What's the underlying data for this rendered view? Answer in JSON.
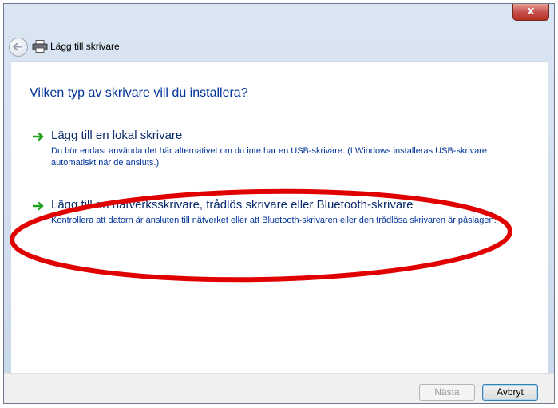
{
  "window": {
    "close_glyph": "x"
  },
  "header": {
    "title": "Lägg till skrivare"
  },
  "content": {
    "question": "Vilken typ av skrivare vill du installera?",
    "options": [
      {
        "title": "Lägg till en lokal skrivare",
        "description": "Du bör endast använda det här alternativet om du inte har en USB-skrivare. (I Windows installeras USB-skrivare automatiskt när de ansluts.)"
      },
      {
        "title": "Lägg till en nätverksskrivare, trådlös skrivare eller Bluetooth-skrivare",
        "description": "Kontrollera att datorn är ansluten till nätverket eller att Bluetooth-skrivaren eller den trådlösa skrivaren är påslagen."
      }
    ]
  },
  "footer": {
    "next_label": "Nästa",
    "cancel_label": "Avbryt"
  },
  "colors": {
    "heading": "#003399",
    "arrow": "#21a121",
    "annotation": "#e00000"
  }
}
